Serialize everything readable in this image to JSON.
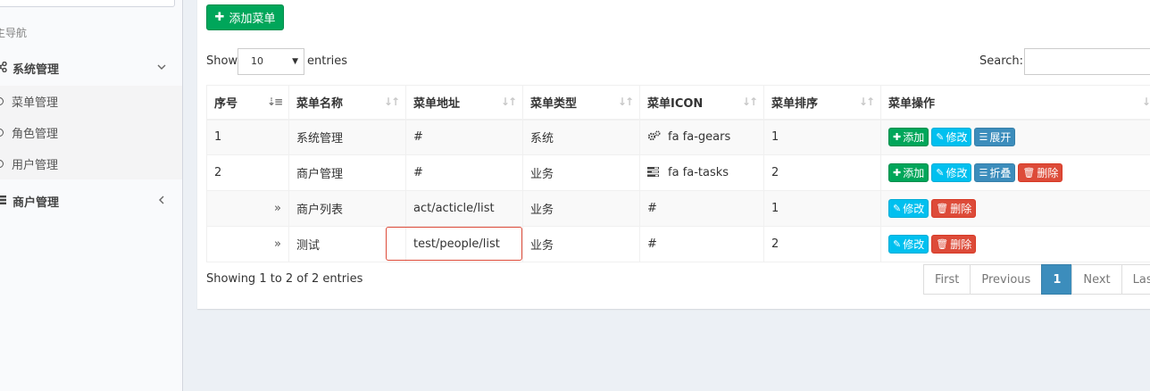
{
  "sidebar": {
    "header": "主导航",
    "menu_system": "系统管理",
    "sub_items": [
      "菜单管理",
      "角色管理",
      "用户管理"
    ],
    "menu_merchant": "商户管理"
  },
  "toolbar": {
    "add_menu_label": "添加菜单"
  },
  "table_controls": {
    "show_label": "Show",
    "page_length": "10",
    "entries_label": "entries",
    "search_label": "Search:",
    "search_value": ""
  },
  "table": {
    "headers": [
      "序号",
      "菜单名称",
      "菜单地址",
      "菜单类型",
      "菜单ICON",
      "菜单排序",
      "菜单操作"
    ],
    "rows": [
      {
        "index": "1",
        "indent": "",
        "name": "系统管理",
        "url": "#",
        "type": "系统",
        "icon_glyph": "gears-icon",
        "icon_text": "fa fa-gears",
        "order": "1",
        "ops": [
          "添加",
          "修改",
          "展开"
        ]
      },
      {
        "index": "2",
        "indent": "",
        "name": "商户管理",
        "url": "#",
        "type": "业务",
        "icon_glyph": "tasks-icon",
        "icon_text": "fa fa-tasks",
        "order": "2",
        "ops": [
          "添加",
          "修改",
          "折叠",
          "删除"
        ]
      },
      {
        "index": "",
        "indent": "»",
        "name": "商户列表",
        "url": "act/acticle/list",
        "type": "业务",
        "icon_glyph": "",
        "icon_text": "#",
        "order": "1",
        "ops": [
          "修改",
          "删除"
        ]
      },
      {
        "index": "",
        "indent": "»",
        "name": "测试",
        "url": "test/people/list",
        "type": "业务",
        "icon_glyph": "",
        "icon_text": "#",
        "order": "2",
        "ops": [
          "修改",
          "删除"
        ]
      }
    ]
  },
  "footer": {
    "info": "Showing 1 to 2 of 2 entries",
    "pager": [
      "First",
      "Previous",
      "1",
      "Next",
      "Last"
    ]
  },
  "colors": {
    "success": "#00a65a",
    "info": "#00c0ef",
    "primary": "#3c8dbc",
    "danger": "#dd4b39"
  }
}
